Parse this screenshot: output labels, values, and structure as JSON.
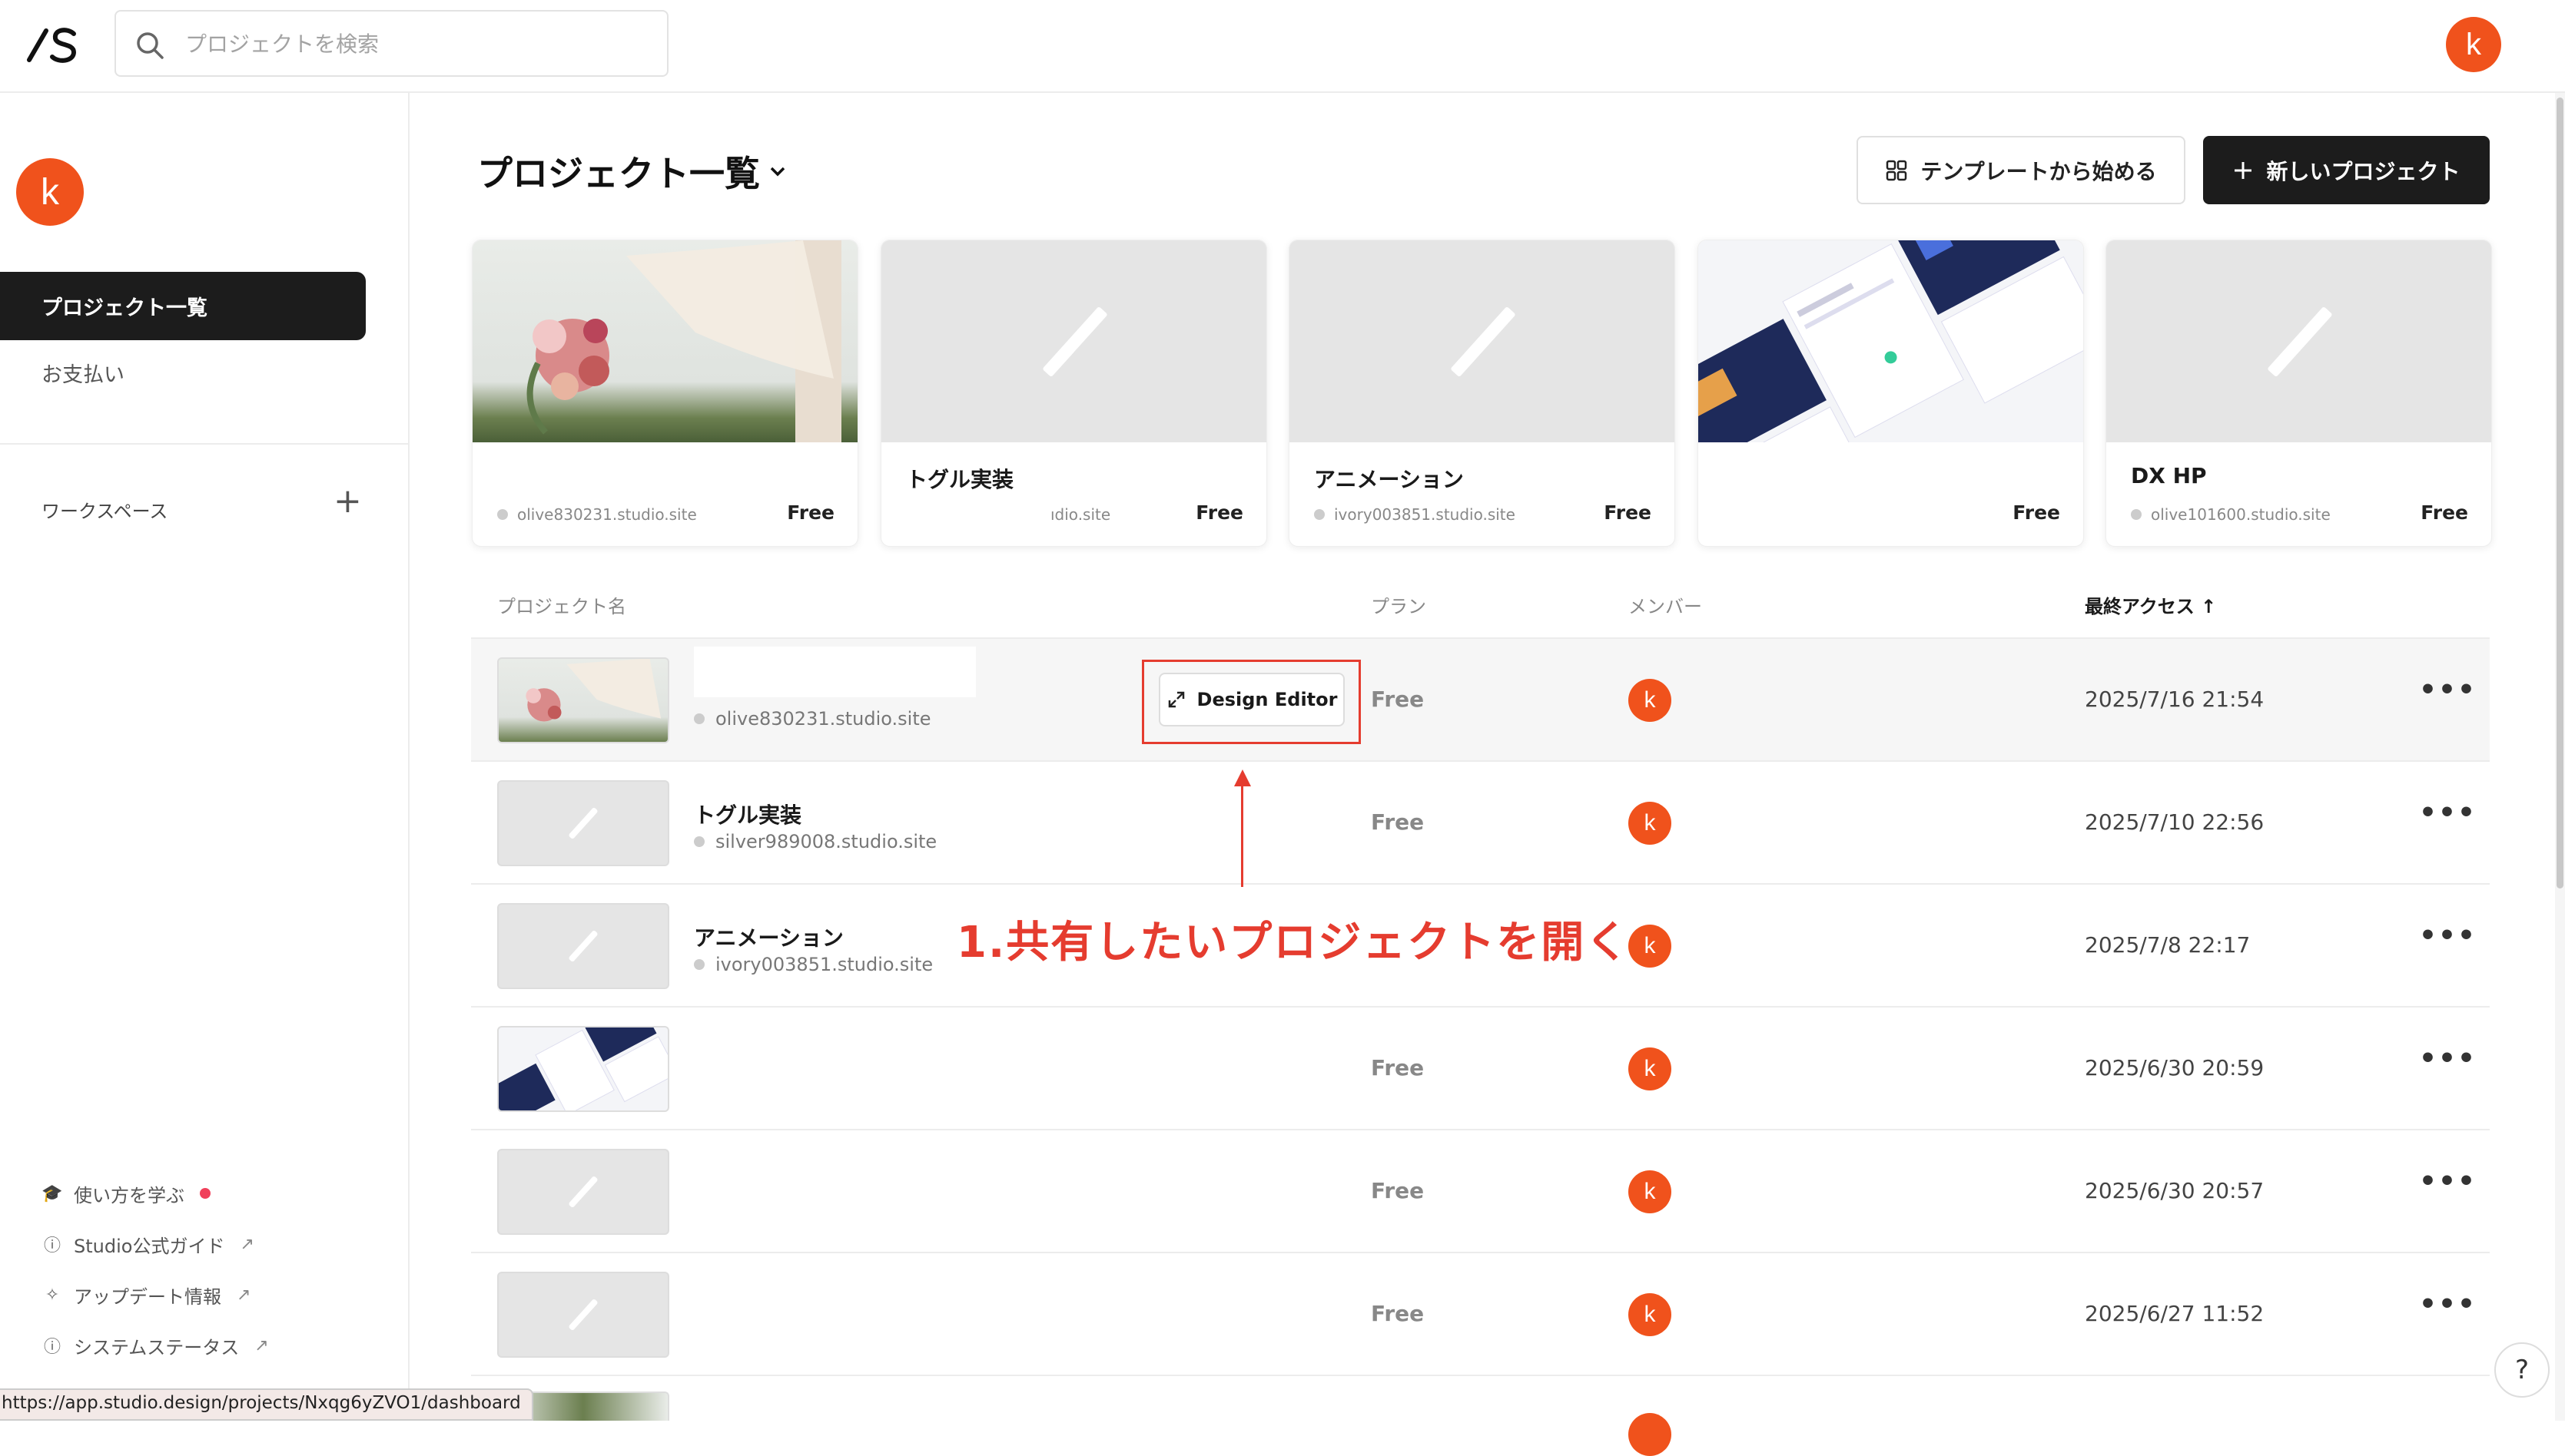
{
  "header": {
    "search_placeholder": "プロジェクトを検索",
    "avatar_letter": "k"
  },
  "sidebar": {
    "avatar_letter": "k",
    "items": [
      {
        "label": "プロジェクト一覧",
        "active": true
      },
      {
        "label": "お支払い",
        "active": false
      }
    ],
    "workspace_label": "ワークスペース",
    "footer_links": [
      {
        "label": "使い方を学ぶ",
        "icon": "graduation-cap-icon"
      },
      {
        "label": "Studio公式ガイド",
        "icon": "question-circle-icon"
      },
      {
        "label": "アップデート情報",
        "icon": "sparkle-icon"
      },
      {
        "label": "システムステータス",
        "icon": "info-circle-icon"
      }
    ]
  },
  "status_url": "https://app.studio.design/projects/Nxqg6yZVO1/dashboard",
  "main": {
    "title": "プロジェクト一覧",
    "template_button": "テンプレートから始める",
    "new_button": "新しいプロジェクト",
    "cards": [
      {
        "name": "",
        "site": "olive830231.studio.site",
        "plan": "Free"
      },
      {
        "name": "トグル実装",
        "site": "ıdio.site",
        "plan": "Free"
      },
      {
        "name": "アニメーション",
        "site": "ivory003851.studio.site",
        "plan": "Free"
      },
      {
        "name": "",
        "site": "",
        "plan": "Free"
      },
      {
        "name": "DX HP",
        "site": "olive101600.studio.site",
        "plan": "Free"
      }
    ],
    "table_headers": {
      "name": "プロジェクト名",
      "plan": "プラン",
      "members": "メンバー",
      "last_access": "最終アクセス"
    },
    "rows": [
      {
        "name": "",
        "site": "olive830231.studio.site",
        "plan": "Free",
        "member": "k",
        "date": "2025/7/16 21:54"
      },
      {
        "name": "トグル実装",
        "site": "silver989008.studio.site",
        "plan": "Free",
        "member": "k",
        "date": "2025/7/10 22:56"
      },
      {
        "name": "アニメーション",
        "site": "ivory003851.studio.site",
        "plan": "Free",
        "member": "k",
        "date": "2025/7/8 22:17"
      },
      {
        "name": "",
        "site": "",
        "plan": "Free",
        "member": "k",
        "date": "2025/6/30 20:59"
      },
      {
        "name": "",
        "site": "",
        "plan": "Free",
        "member": "k",
        "date": "2025/6/30 20:57"
      },
      {
        "name": "",
        "site": "",
        "plan": "Free",
        "member": "k",
        "date": "2025/6/27 11:52"
      }
    ],
    "design_editor_label": "Design Editor",
    "annotation": "1.共有したいプロジェクトを開く"
  },
  "colors": {
    "accent": "#f0521c",
    "annotation_red": "#e53c2f",
    "dark": "#1c1c1c"
  }
}
